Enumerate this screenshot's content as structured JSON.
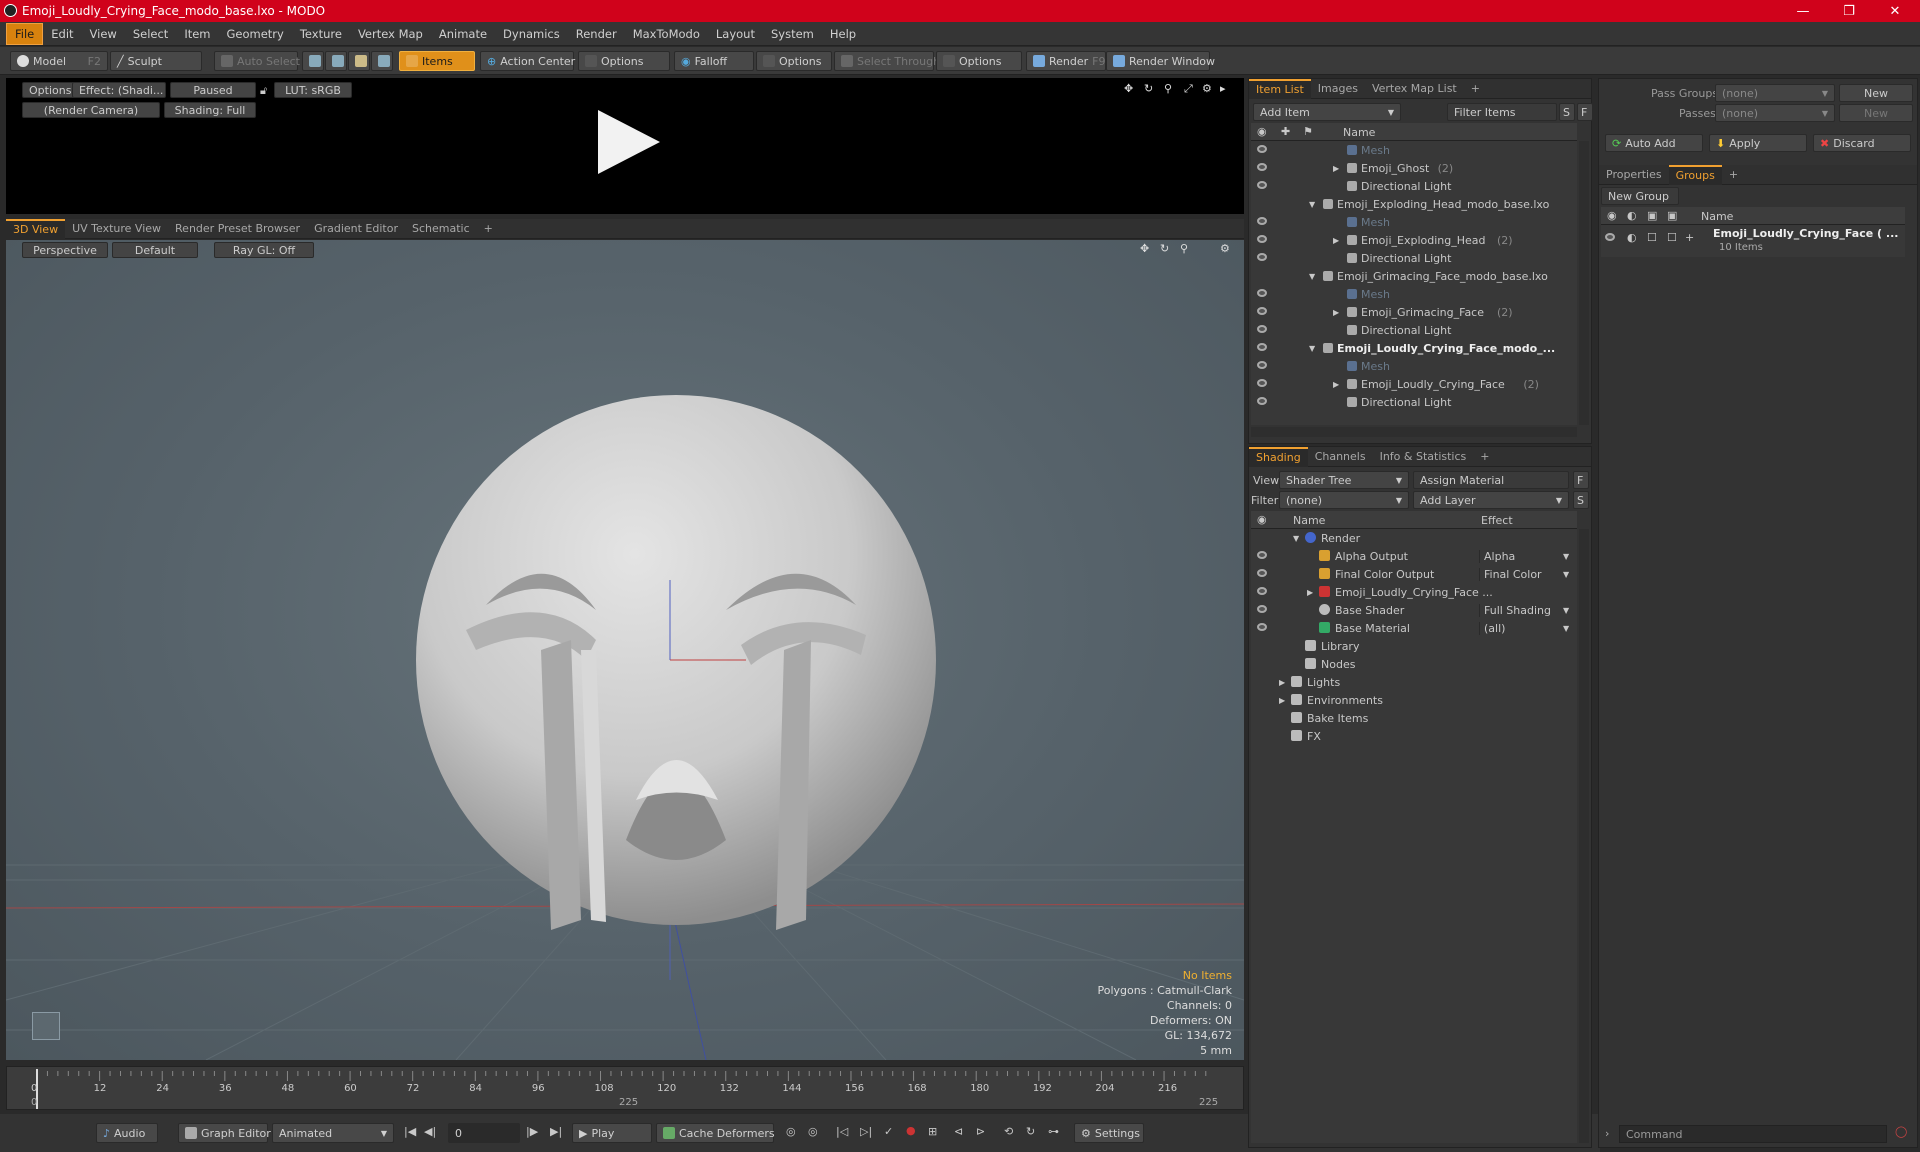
{
  "window": {
    "title": "Emoji_Loudly_Crying_Face_modo_base.lxo - MODO"
  },
  "menu": [
    "File",
    "Edit",
    "View",
    "Select",
    "Item",
    "Geometry",
    "Texture",
    "Vertex Map",
    "Animate",
    "Dynamics",
    "Render",
    "MaxToModo",
    "Layout",
    "System",
    "Help"
  ],
  "toolbar": {
    "model": "Model",
    "model_key": "F2",
    "sculpt": "Sculpt",
    "auto_select": "Auto Select",
    "items": "Items",
    "action_center": "Action Center",
    "options1": "Options",
    "falloff": "Falloff",
    "options2": "Options",
    "select_through": "Select Through",
    "options3": "Options",
    "render": "Render",
    "render_key": "F9",
    "render_window": "Render Window"
  },
  "preview": {
    "options": "Options",
    "effect": "Effect: (Shadi...",
    "paused": "Paused",
    "lut": "LUT: sRGB",
    "camera": "(Render Camera)",
    "shading": "Shading: Full"
  },
  "viewport_tabs": [
    "3D View",
    "UV Texture View",
    "Render Preset Browser",
    "Gradient Editor",
    "Schematic"
  ],
  "viewport": {
    "perspective": "Perspective",
    "default": "Default",
    "raygl": "Ray GL: Off"
  },
  "hud": {
    "no_items": "No Items",
    "polygons": "Polygons : Catmull-Clark",
    "channels": "Channels: 0",
    "deformers": "Deformers: ON",
    "gl": "GL: 134,672",
    "unit": "5 mm"
  },
  "timeline": {
    "ticks": [
      "0",
      "12",
      "24",
      "36",
      "48",
      "60",
      "72",
      "84",
      "96",
      "108",
      "120",
      "132",
      "144",
      "156",
      "168",
      "180",
      "192",
      "204",
      "216"
    ],
    "start": "0",
    "mid": "225",
    "end": "225"
  },
  "bottom": {
    "audio": "Audio",
    "graph_editor": "Graph Editor",
    "animated": "Animated",
    "frame": "0",
    "play": "Play",
    "cache": "Cache Deformers",
    "settings": "Settings"
  },
  "itemlist": {
    "tabs": [
      "Item List",
      "Images",
      "Vertex Map List"
    ],
    "add_item": "Add Item",
    "filter": "Filter Items",
    "s": "S",
    "f": "F",
    "col_name": "Name",
    "rows": [
      {
        "label": "Mesh",
        "indent": 3,
        "dim": true,
        "eye": true
      },
      {
        "label": "Emoji_Ghost",
        "count": "(2)",
        "indent": 3,
        "arrow": "▶",
        "eye": true
      },
      {
        "label": "Directional Light",
        "indent": 3,
        "eye": true
      },
      {
        "label": "Emoji_Exploding_Head_modo_base.lxo",
        "indent": 1,
        "arrow": "▼",
        "eye": false
      },
      {
        "label": "Mesh",
        "indent": 3,
        "dim": true,
        "eye": true
      },
      {
        "label": "Emoji_Exploding_Head",
        "count": "(2)",
        "indent": 3,
        "arrow": "▶",
        "eye": true
      },
      {
        "label": "Directional Light",
        "indent": 3,
        "eye": true
      },
      {
        "label": "Emoji_Grimacing_Face_modo_base.lxo",
        "indent": 1,
        "arrow": "▼",
        "eye": false
      },
      {
        "label": "Mesh",
        "indent": 3,
        "dim": true,
        "eye": true
      },
      {
        "label": "Emoji_Grimacing_Face",
        "count": "(2)",
        "indent": 3,
        "arrow": "▶",
        "eye": true
      },
      {
        "label": "Directional Light",
        "indent": 3,
        "eye": true
      },
      {
        "label": "Emoji_Loudly_Crying_Face_modo_...",
        "indent": 1,
        "arrow": "▼",
        "bold": true,
        "eye": true
      },
      {
        "label": "Mesh",
        "indent": 3,
        "dim": true,
        "eye": true
      },
      {
        "label": "Emoji_Loudly_Crying_Face",
        "count": "(2)",
        "indent": 3,
        "arrow": "▶",
        "eye": true
      },
      {
        "label": "Directional Light",
        "indent": 3,
        "eye": true
      }
    ]
  },
  "shading": {
    "tabs": [
      "Shading",
      "Channels",
      "Info & Statistics"
    ],
    "view_label": "View",
    "view": "Shader Tree",
    "assign": "Assign Material",
    "filter_label": "Filter",
    "filter": "(none)",
    "add_layer": "Add Layer",
    "f": "F",
    "s": "S",
    "col_name": "Name",
    "col_effect": "Effect",
    "rows": [
      {
        "label": "Render",
        "effect": "",
        "indent": 1,
        "arrow": "▼",
        "eye": false
      },
      {
        "label": "Alpha Output",
        "effect": "Alpha",
        "indent": 2,
        "eye": true
      },
      {
        "label": "Final Color Output",
        "effect": "Final Color",
        "indent": 2,
        "eye": true
      },
      {
        "label": "Emoji_Loudly_Crying_Face ...",
        "effect": "",
        "indent": 2,
        "arrow": "▶",
        "eye": true
      },
      {
        "label": "Base Shader",
        "effect": "Full Shading",
        "indent": 2,
        "eye": true
      },
      {
        "label": "Base Material",
        "effect": "(all)",
        "indent": 2,
        "eye": true
      },
      {
        "label": "Library",
        "effect": "",
        "indent": 1,
        "eye": false
      },
      {
        "label": "Nodes",
        "effect": "",
        "indent": 1,
        "eye": false
      },
      {
        "label": "Lights",
        "effect": "",
        "indent": 0,
        "arrow": "▶",
        "eye": false
      },
      {
        "label": "Environments",
        "effect": "",
        "indent": 0,
        "arrow": "▶",
        "eye": false
      },
      {
        "label": "Bake Items",
        "effect": "",
        "indent": 0,
        "eye": false
      },
      {
        "label": "FX",
        "effect": "",
        "indent": 0,
        "eye": false
      }
    ]
  },
  "right": {
    "pass_groups": "Pass Groups",
    "passes": "Passes",
    "none1": "(none)",
    "none2": "(none)",
    "new1": "New",
    "new2": "New",
    "auto_add": "Auto Add",
    "apply": "Apply",
    "discard": "Discard",
    "tabs": [
      "Properties",
      "Groups"
    ],
    "new_group": "New Group",
    "col_name": "Name",
    "group_name": "Emoji_Loudly_Crying_Face ( ...",
    "group_items": "10 Items",
    "command": "Command"
  }
}
